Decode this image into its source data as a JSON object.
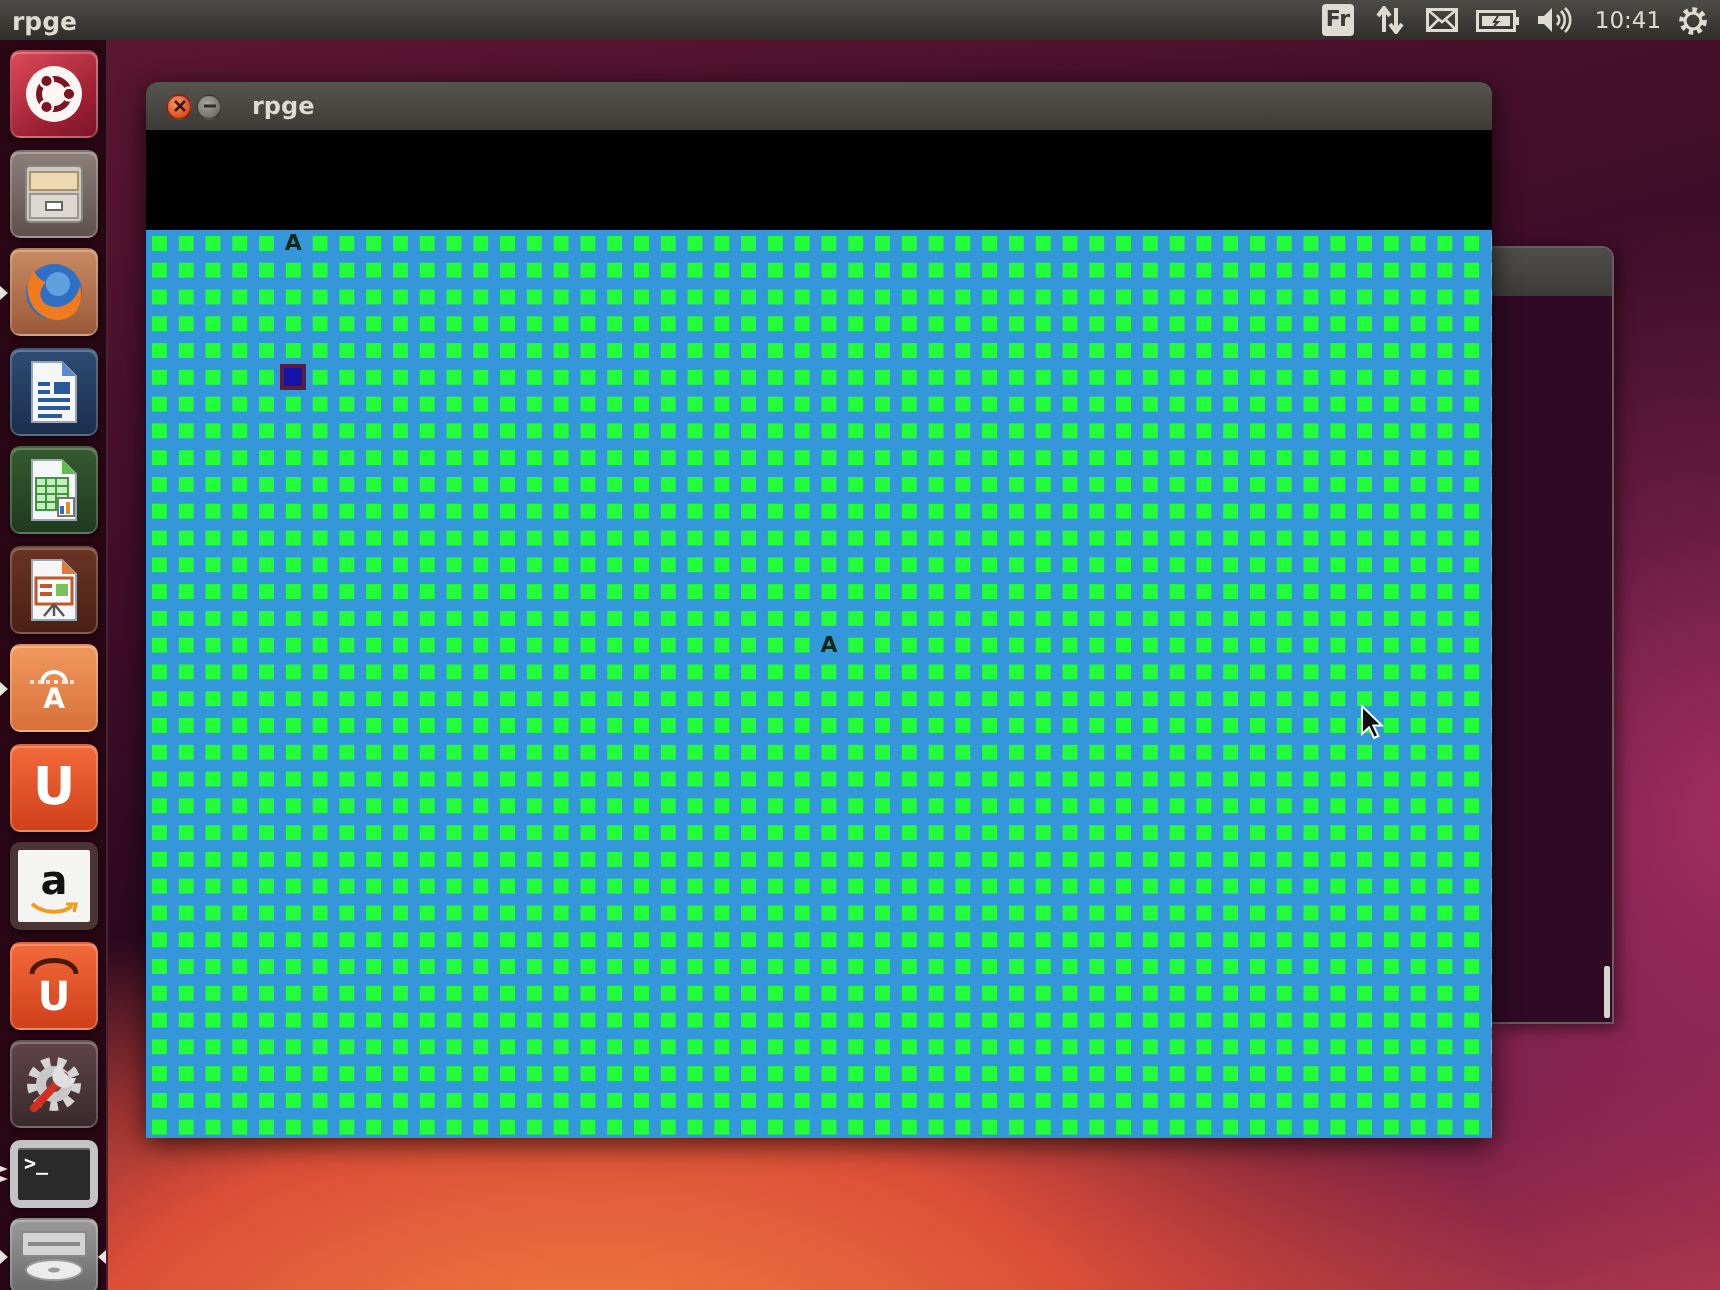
{
  "top_panel": {
    "app_name": "rpge",
    "indicators": [
      {
        "kind": "keyboard",
        "label": "Fr"
      },
      {
        "kind": "network"
      },
      {
        "kind": "mail"
      },
      {
        "kind": "battery"
      },
      {
        "kind": "volume"
      },
      {
        "kind": "clock",
        "label": "10:41"
      },
      {
        "kind": "session"
      }
    ]
  },
  "launcher": {
    "items": [
      {
        "kind": "dash",
        "running": false,
        "multiple_windows": false,
        "focused": false
      },
      {
        "kind": "files",
        "running": false,
        "multiple_windows": false,
        "focused": false
      },
      {
        "kind": "browser",
        "running": true,
        "multiple_windows": false,
        "focused": false
      },
      {
        "kind": "writer",
        "running": false,
        "multiple_windows": false,
        "focused": false
      },
      {
        "kind": "spreadsheet",
        "running": false,
        "multiple_windows": false,
        "focused": false
      },
      {
        "kind": "presentation",
        "running": false,
        "multiple_windows": false,
        "focused": false
      },
      {
        "kind": "software",
        "glyph": "A",
        "running": true,
        "multiple_windows": false,
        "focused": false
      },
      {
        "kind": "cloud",
        "glyph": "U",
        "running": false,
        "multiple_windows": false,
        "focused": false
      },
      {
        "kind": "store",
        "glyph": "a",
        "running": false,
        "multiple_windows": false,
        "focused": false
      },
      {
        "kind": "music",
        "glyph": "U",
        "running": false,
        "multiple_windows": false,
        "focused": false
      },
      {
        "kind": "settings",
        "running": false,
        "multiple_windows": false,
        "focused": false
      },
      {
        "kind": "terminal",
        "glyph": ">_",
        "running": true,
        "multiple_windows": true,
        "focused": false
      },
      {
        "kind": "drive",
        "running": true,
        "multiple_windows": false,
        "focused": true
      }
    ]
  },
  "window": {
    "title": "rpge",
    "map": {
      "markers": [
        {
          "kind": "letter",
          "text": "A"
        },
        {
          "kind": "highlight"
        },
        {
          "kind": "letter",
          "text": "A"
        }
      ]
    }
  }
}
